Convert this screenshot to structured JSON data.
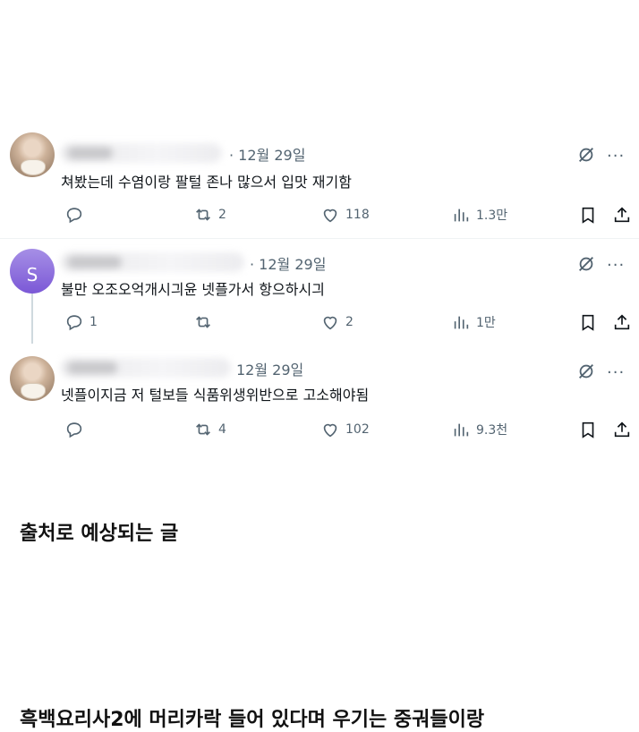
{
  "posts": [
    {
      "date": "· 12월 29일",
      "text": "쳐봤는데 수염이랑 팔털 존나 많으서 입맛 재기함",
      "replies": "",
      "reposts": "2",
      "likes": "118",
      "views": "1.3만"
    },
    {
      "avatar_letter": "S",
      "date": "· 12월 29일",
      "text": "불만 오조오억개시긔윤 넷플가서 항으하시긔",
      "replies": "1",
      "reposts": "",
      "likes": "2",
      "views": "1만"
    },
    {
      "date": "12월 29일",
      "text": "넷플이지금 저 털보들 식품위생위반으로 고소해야됨",
      "replies": "",
      "reposts": "4",
      "likes": "102",
      "views": "9.3천"
    }
  ],
  "captions": {
    "first": "출처로 예상되는 글",
    "second": "흑백요리사2에 머리카락 들어 있다며 우기는 중궈들이랑"
  },
  "icons": {
    "reply": "reply-icon",
    "repost": "repost-icon",
    "like": "heart-icon",
    "views": "views-icon",
    "bookmark": "bookmark-icon",
    "share": "share-icon",
    "grok": "grok-icon",
    "more": "more-icon"
  },
  "colors": {
    "icon_gray": "#536471",
    "text": "#0f1419",
    "avatar_purple": "#7b58d6"
  }
}
